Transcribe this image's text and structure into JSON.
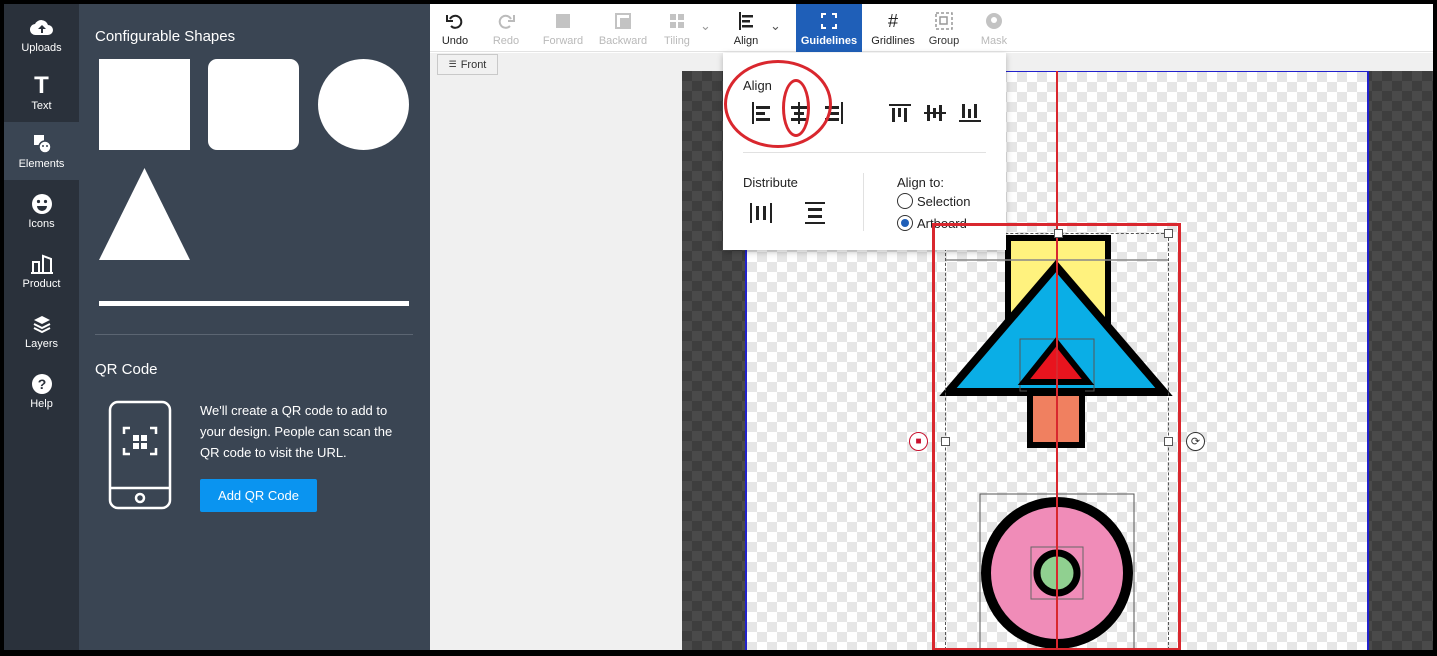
{
  "rail": {
    "items": [
      {
        "label": "Uploads",
        "icon": "cloud-upload-icon"
      },
      {
        "label": "Text",
        "icon": "text-icon"
      },
      {
        "label": "Elements",
        "icon": "elements-icon",
        "active": true
      },
      {
        "label": "Icons",
        "icon": "smiley-icon"
      },
      {
        "label": "Product",
        "icon": "product-icon"
      },
      {
        "label": "Layers",
        "icon": "layers-icon"
      },
      {
        "label": "Help",
        "icon": "help-icon"
      }
    ]
  },
  "panel": {
    "shapes_title": "Configurable Shapes",
    "qr_title": "QR Code",
    "qr_description": "We'll create a QR code to add to your design. People can scan the QR code to visit the URL.",
    "qr_button": "Add QR Code"
  },
  "toolbar": {
    "undo": "Undo",
    "redo": "Redo",
    "forward": "Forward",
    "backward": "Backward",
    "tiling": "Tiling",
    "align": "Align",
    "guidelines": "Guidelines",
    "gridlines": "Gridlines",
    "group": "Group",
    "mask": "Mask"
  },
  "canvas": {
    "front_label": "Front"
  },
  "align_menu": {
    "align_label": "Align",
    "distribute_label": "Distribute",
    "align_to_label": "Align to:",
    "options": [
      "Selection",
      "Artboard"
    ],
    "selected_option": "Artboard"
  },
  "colors": {
    "rail_bg": "#2a313b",
    "panel_bg": "#3a4553",
    "accent": "#1f5fb8",
    "button_blue": "#0a94f0",
    "annotation_red": "#d9272e",
    "yellow": "#fff27e",
    "cyan": "#0aaee6",
    "red": "#e8141e",
    "salmon": "#f08060",
    "pink": "#f08cb8",
    "green": "#90d090"
  }
}
